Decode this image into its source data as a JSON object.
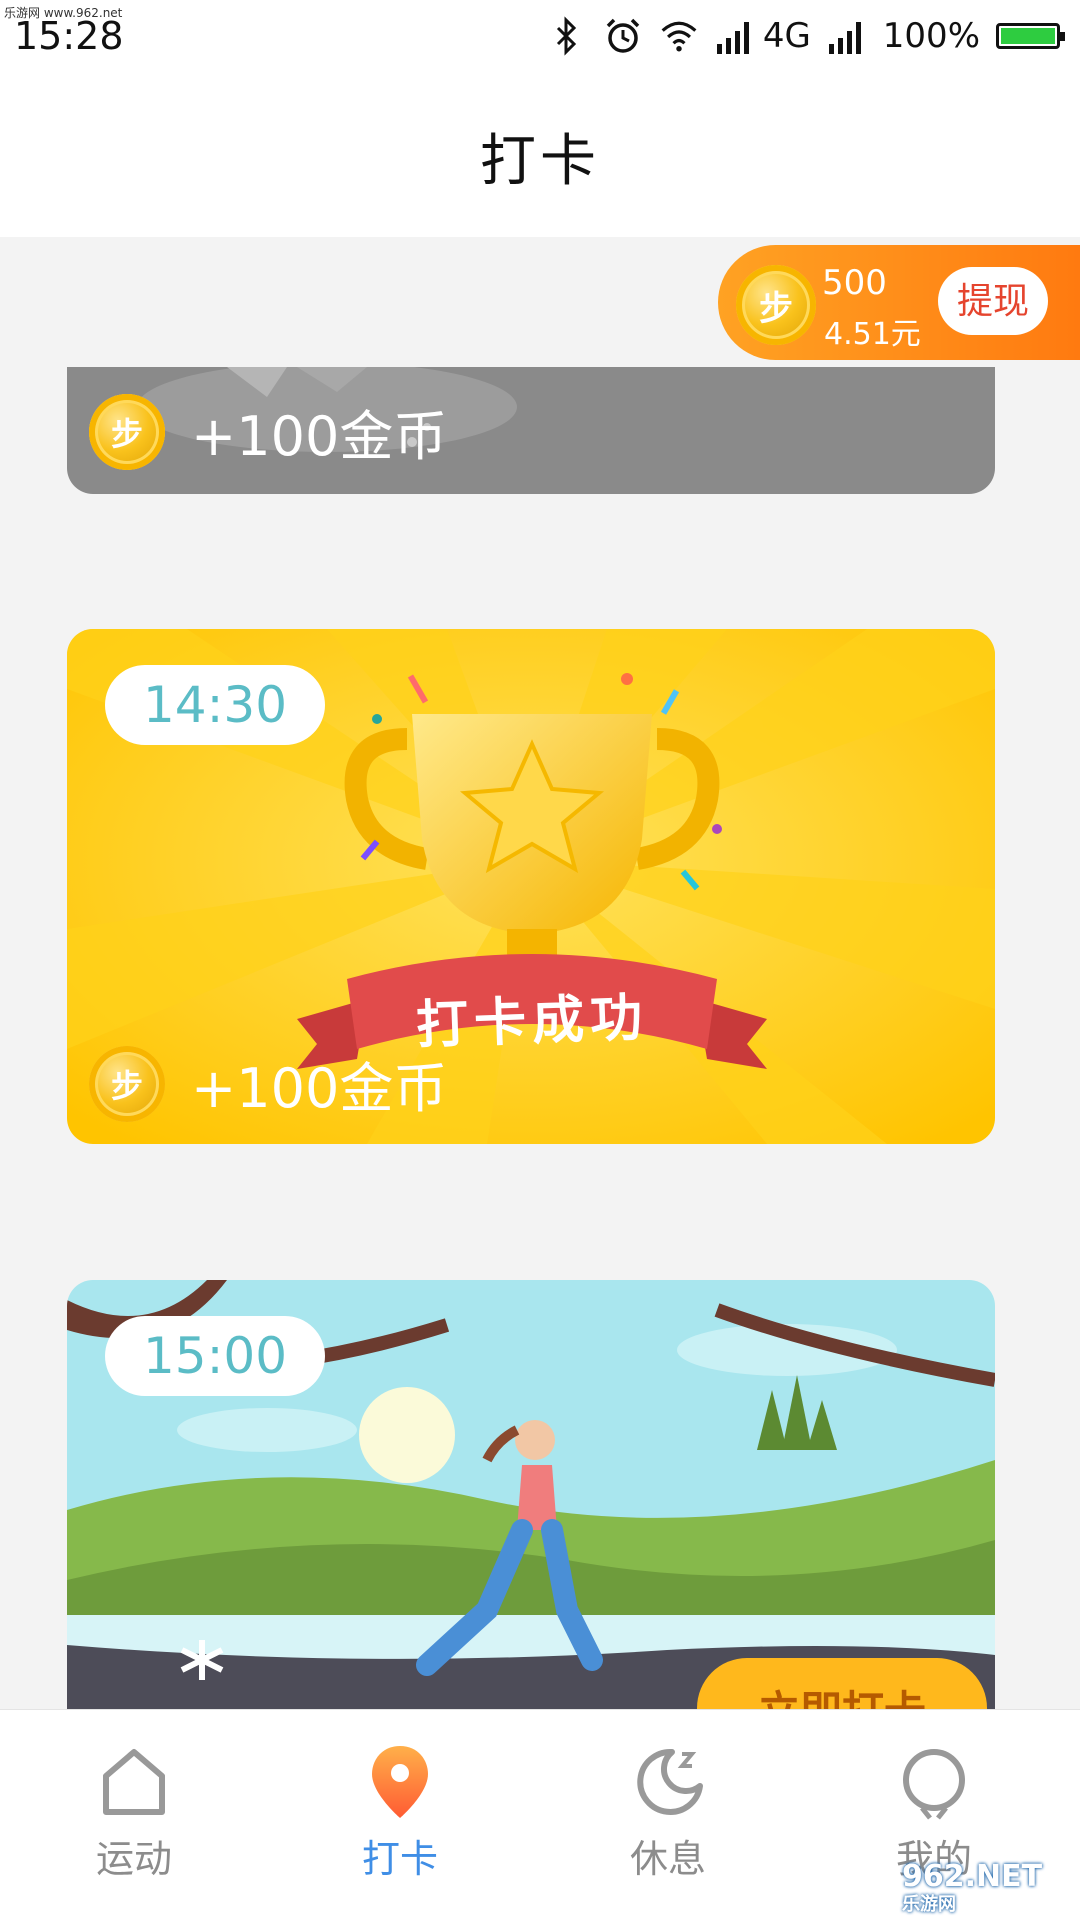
{
  "watermark": {
    "top": "乐游网 www.962.net",
    "bottom_logo": "962.NET",
    "bottom_sub": "乐游网"
  },
  "status_bar": {
    "time": "15:28",
    "network": "4G",
    "battery": "100%"
  },
  "header": {
    "title": "打卡"
  },
  "balance": {
    "coins": "500",
    "cash": "4.51元",
    "withdraw_label": "提现",
    "coin_glyph": "步"
  },
  "cards": [
    {
      "reward": "+100金币"
    },
    {
      "time": "14:30",
      "banner": "打卡成功",
      "reward": "+100金币"
    },
    {
      "time": "15:00",
      "action_label": "立即打卡"
    }
  ],
  "nav": {
    "items": [
      {
        "label": "运动",
        "icon": "home-icon"
      },
      {
        "label": "打卡",
        "icon": "location-pin-icon",
        "active": true
      },
      {
        "label": "休息",
        "icon": "moon-icon"
      },
      {
        "label": "我的",
        "icon": "profile-icon"
      }
    ]
  },
  "colors": {
    "accent": "#3f8ee6",
    "balance_gradient_start": "#ffa223",
    "balance_gradient_end": "#ff7a10",
    "time_text": "#5bbcc6",
    "card_yellow": "#ffcc00"
  }
}
